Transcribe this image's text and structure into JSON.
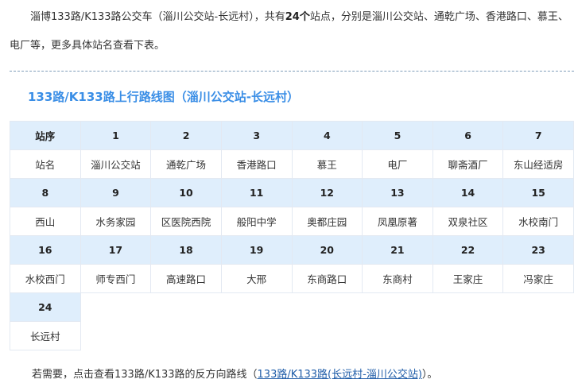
{
  "intro": {
    "part1": "淄博133路/K133路公交车（淄川公交站-长远村），共有",
    "count": "24个",
    "part2": "站点，分别是淄川公交站、通乾广场、香港路口、慕王、电厂等，更多具体站名查看下表。"
  },
  "route_title": "133路/K133路上行路线图（淄川公交站-长远村）",
  "table": {
    "seq_header": "站序",
    "name_header": "站名",
    "stations": [
      {
        "no": "1",
        "name": "淄川公交站"
      },
      {
        "no": "2",
        "name": "通乾广场"
      },
      {
        "no": "3",
        "name": "香港路口"
      },
      {
        "no": "4",
        "name": "慕王"
      },
      {
        "no": "5",
        "name": "电厂"
      },
      {
        "no": "6",
        "name": "聊斋酒厂"
      },
      {
        "no": "7",
        "name": "东山经适房"
      },
      {
        "no": "8",
        "name": "西山"
      },
      {
        "no": "9",
        "name": "水务家园"
      },
      {
        "no": "10",
        "name": "区医院西院"
      },
      {
        "no": "11",
        "name": "般阳中学"
      },
      {
        "no": "12",
        "name": "奥都庄园"
      },
      {
        "no": "13",
        "name": "凤凰原著"
      },
      {
        "no": "14",
        "name": "双泉社区"
      },
      {
        "no": "15",
        "name": "水校南门"
      },
      {
        "no": "16",
        "name": "水校西门"
      },
      {
        "no": "17",
        "name": "师专西门"
      },
      {
        "no": "18",
        "name": "高速路口"
      },
      {
        "no": "19",
        "name": "大邢"
      },
      {
        "no": "20",
        "name": "东商路口"
      },
      {
        "no": "21",
        "name": "东商村"
      },
      {
        "no": "22",
        "name": "王家庄"
      },
      {
        "no": "23",
        "name": "冯家庄"
      },
      {
        "no": "24",
        "name": "长远村"
      }
    ]
  },
  "footer": {
    "prefix": "若需要，点击查看133路/K133路的反方向路线（",
    "link": "133路/K133路(长远村-淄川公交站)",
    "suffix": "）。"
  }
}
